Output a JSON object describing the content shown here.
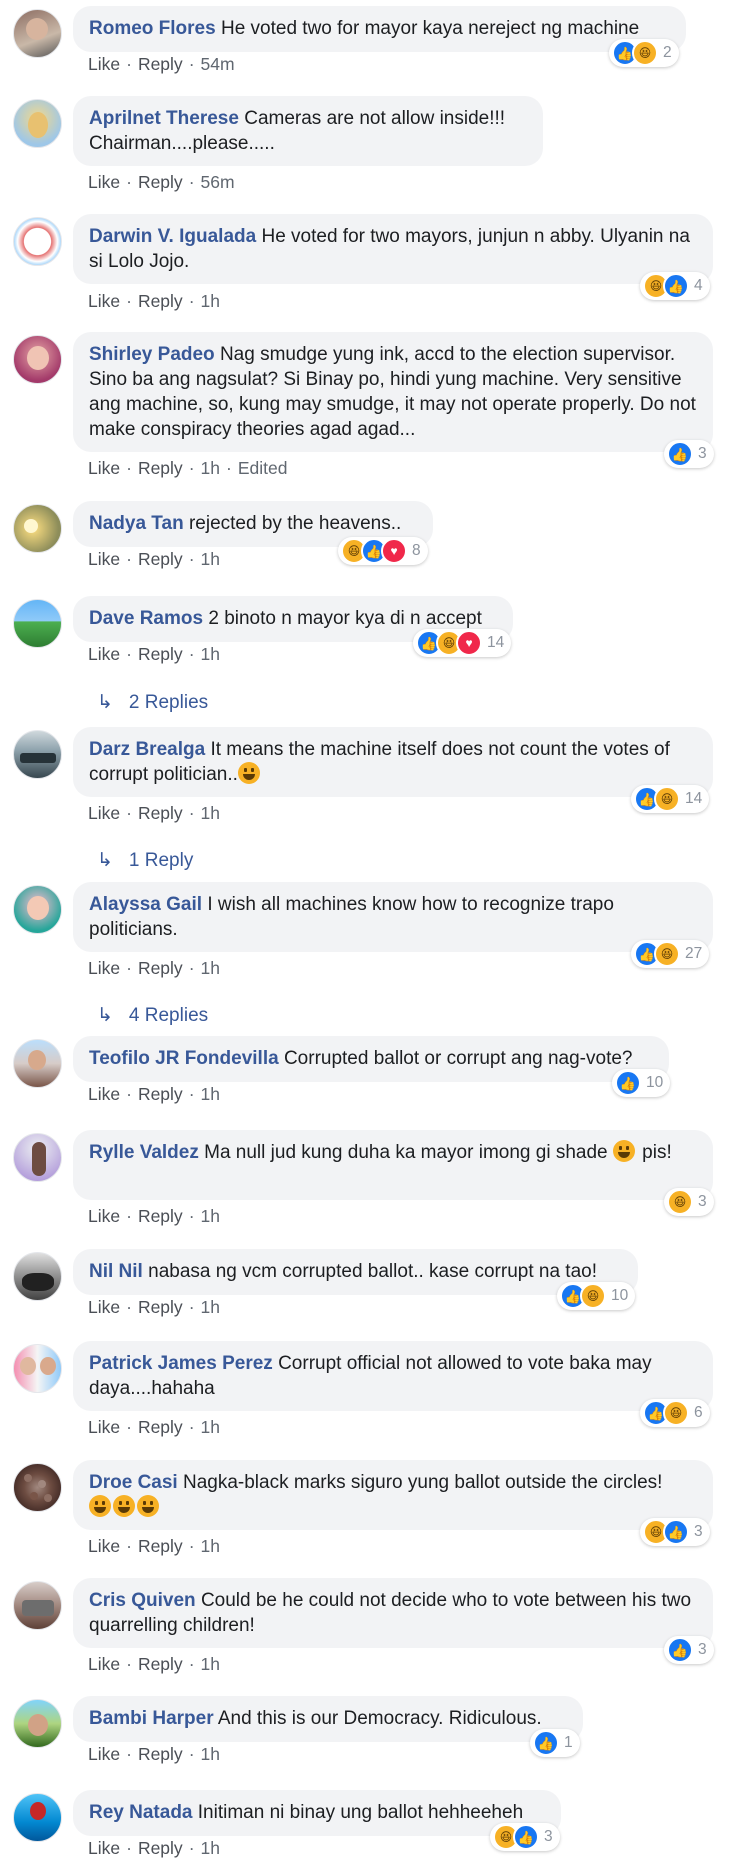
{
  "labels": {
    "like": "Like",
    "reply": "Reply"
  },
  "colors": {
    "author": "#385898",
    "bubble": "#f2f3f5",
    "meta": "#606770",
    "like_blue": "#1877f2",
    "haha_yellow": "#f7b125",
    "love_red": "#f0284a"
  },
  "comments": [
    {
      "author": "Romeo Flores",
      "text": "He voted two for mayor kaya nereject ng machine",
      "time": "54m",
      "reactions": [
        "like",
        "haha"
      ],
      "count": "2"
    },
    {
      "author": "Aprilnet Therese",
      "text": "Cameras are not allow inside!!! Chairman....please.....",
      "time": "56m"
    },
    {
      "author": "Darwin V. Igualada",
      "text": "He voted for two mayors, junjun n abby. Ulyanin na si Lolo Jojo.",
      "time": "1h",
      "reactions": [
        "haha",
        "like"
      ],
      "count": "4"
    },
    {
      "author": "Shirley Padeo",
      "text": "Nag smudge yung ink, accd to the election supervisor. Sino ba ang nagsulat? Si Binay po, hindi yung machine. Very sensitive ang machine, so, kung may smudge, it may not operate properly. Do not make conspiracy theories agad agad...",
      "time": "1h",
      "edited": "Edited",
      "reactions": [
        "like"
      ],
      "count": "3"
    },
    {
      "author": "Nadya Tan",
      "text": "rejected by the heavens..",
      "time": "1h",
      "reactions": [
        "haha",
        "like",
        "love"
      ],
      "count": "8"
    },
    {
      "author": "Dave Ramos",
      "text": "2 binoto n mayor kya di n accept",
      "time": "1h",
      "reactions": [
        "like",
        "haha",
        "love"
      ],
      "count": "14",
      "replies": "2 Replies"
    },
    {
      "author": "Darz Brealga",
      "text": "It means the machine itself does not count the votes of corrupt politician..",
      "time": "1h",
      "reactions": [
        "like",
        "haha"
      ],
      "count": "14",
      "replies": "1 Reply"
    },
    {
      "author": "Alayssa Gail",
      "text": "I wish all machines know how to recognize trapo politicians.",
      "time": "1h",
      "reactions": [
        "like",
        "haha"
      ],
      "count": "27",
      "replies": "4 Replies"
    },
    {
      "author": "Teofilo JR Fondevilla",
      "text": "Corrupted ballot or corrupt ang nag-vote?",
      "time": "1h",
      "reactions": [
        "like"
      ],
      "count": "10"
    },
    {
      "author": "Rylle Valdez",
      "text": "Ma null jud kung duha ka mayor imong gi shade",
      "text2": "pis!",
      "time": "1h",
      "reactions": [
        "haha"
      ],
      "count": "3"
    },
    {
      "author": "Nil Nil",
      "text": "nabasa ng vcm corrupted ballot.. kase corrupt na tao!",
      "time": "1h",
      "reactions": [
        "like",
        "haha"
      ],
      "count": "10"
    },
    {
      "author": "Patrick James Perez",
      "text": "Corrupt official not allowed to vote baka may daya....hahaha",
      "time": "1h",
      "reactions": [
        "like",
        "haha"
      ],
      "count": "6"
    },
    {
      "author": "Droe Casi",
      "text": "Nagka-black marks siguro yung ballot outside the circles!",
      "time": "1h",
      "reactions": [
        "haha",
        "like"
      ],
      "count": "3"
    },
    {
      "author": "Cris Quiven",
      "text": "Could be he could not decide who to vote between his two quarrelling children!",
      "time": "1h",
      "reactions": [
        "like"
      ],
      "count": "3"
    },
    {
      "author": "Bambi Harper",
      "text": "And this is our Democracy. Ridiculous.",
      "time": "1h",
      "reactions": [
        "like"
      ],
      "count": "1"
    },
    {
      "author": "Rey Natada",
      "text": "Initiman ni binay ung ballot hehheeheh",
      "time": "1h",
      "reactions": [
        "haha",
        "like"
      ],
      "count": "3"
    }
  ]
}
